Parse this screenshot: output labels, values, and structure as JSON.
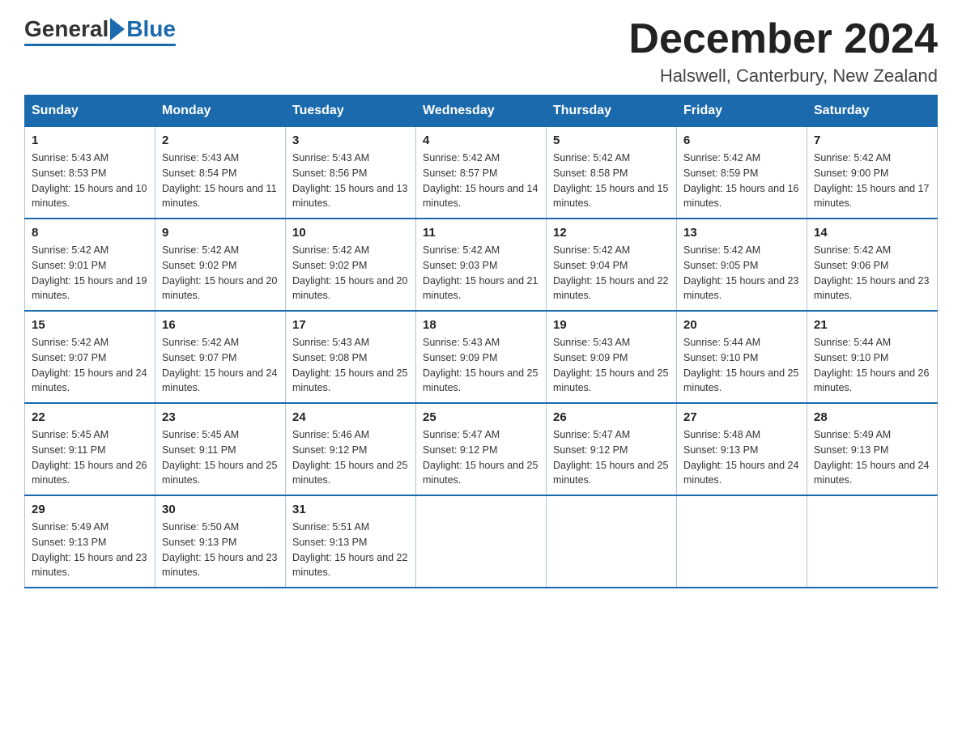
{
  "logo": {
    "general": "General",
    "blue": "Blue"
  },
  "title": "December 2024",
  "location": "Halswell, Canterbury, New Zealand",
  "days_of_week": [
    "Sunday",
    "Monday",
    "Tuesday",
    "Wednesday",
    "Thursday",
    "Friday",
    "Saturday"
  ],
  "weeks": [
    [
      {
        "day": "1",
        "sunrise": "5:43 AM",
        "sunset": "8:53 PM",
        "daylight": "15 hours and 10 minutes."
      },
      {
        "day": "2",
        "sunrise": "5:43 AM",
        "sunset": "8:54 PM",
        "daylight": "15 hours and 11 minutes."
      },
      {
        "day": "3",
        "sunrise": "5:43 AM",
        "sunset": "8:56 PM",
        "daylight": "15 hours and 13 minutes."
      },
      {
        "day": "4",
        "sunrise": "5:42 AM",
        "sunset": "8:57 PM",
        "daylight": "15 hours and 14 minutes."
      },
      {
        "day": "5",
        "sunrise": "5:42 AM",
        "sunset": "8:58 PM",
        "daylight": "15 hours and 15 minutes."
      },
      {
        "day": "6",
        "sunrise": "5:42 AM",
        "sunset": "8:59 PM",
        "daylight": "15 hours and 16 minutes."
      },
      {
        "day": "7",
        "sunrise": "5:42 AM",
        "sunset": "9:00 PM",
        "daylight": "15 hours and 17 minutes."
      }
    ],
    [
      {
        "day": "8",
        "sunrise": "5:42 AM",
        "sunset": "9:01 PM",
        "daylight": "15 hours and 19 minutes."
      },
      {
        "day": "9",
        "sunrise": "5:42 AM",
        "sunset": "9:02 PM",
        "daylight": "15 hours and 20 minutes."
      },
      {
        "day": "10",
        "sunrise": "5:42 AM",
        "sunset": "9:02 PM",
        "daylight": "15 hours and 20 minutes."
      },
      {
        "day": "11",
        "sunrise": "5:42 AM",
        "sunset": "9:03 PM",
        "daylight": "15 hours and 21 minutes."
      },
      {
        "day": "12",
        "sunrise": "5:42 AM",
        "sunset": "9:04 PM",
        "daylight": "15 hours and 22 minutes."
      },
      {
        "day": "13",
        "sunrise": "5:42 AM",
        "sunset": "9:05 PM",
        "daylight": "15 hours and 23 minutes."
      },
      {
        "day": "14",
        "sunrise": "5:42 AM",
        "sunset": "9:06 PM",
        "daylight": "15 hours and 23 minutes."
      }
    ],
    [
      {
        "day": "15",
        "sunrise": "5:42 AM",
        "sunset": "9:07 PM",
        "daylight": "15 hours and 24 minutes."
      },
      {
        "day": "16",
        "sunrise": "5:42 AM",
        "sunset": "9:07 PM",
        "daylight": "15 hours and 24 minutes."
      },
      {
        "day": "17",
        "sunrise": "5:43 AM",
        "sunset": "9:08 PM",
        "daylight": "15 hours and 25 minutes."
      },
      {
        "day": "18",
        "sunrise": "5:43 AM",
        "sunset": "9:09 PM",
        "daylight": "15 hours and 25 minutes."
      },
      {
        "day": "19",
        "sunrise": "5:43 AM",
        "sunset": "9:09 PM",
        "daylight": "15 hours and 25 minutes."
      },
      {
        "day": "20",
        "sunrise": "5:44 AM",
        "sunset": "9:10 PM",
        "daylight": "15 hours and 25 minutes."
      },
      {
        "day": "21",
        "sunrise": "5:44 AM",
        "sunset": "9:10 PM",
        "daylight": "15 hours and 26 minutes."
      }
    ],
    [
      {
        "day": "22",
        "sunrise": "5:45 AM",
        "sunset": "9:11 PM",
        "daylight": "15 hours and 26 minutes."
      },
      {
        "day": "23",
        "sunrise": "5:45 AM",
        "sunset": "9:11 PM",
        "daylight": "15 hours and 25 minutes."
      },
      {
        "day": "24",
        "sunrise": "5:46 AM",
        "sunset": "9:12 PM",
        "daylight": "15 hours and 25 minutes."
      },
      {
        "day": "25",
        "sunrise": "5:47 AM",
        "sunset": "9:12 PM",
        "daylight": "15 hours and 25 minutes."
      },
      {
        "day": "26",
        "sunrise": "5:47 AM",
        "sunset": "9:12 PM",
        "daylight": "15 hours and 25 minutes."
      },
      {
        "day": "27",
        "sunrise": "5:48 AM",
        "sunset": "9:13 PM",
        "daylight": "15 hours and 24 minutes."
      },
      {
        "day": "28",
        "sunrise": "5:49 AM",
        "sunset": "9:13 PM",
        "daylight": "15 hours and 24 minutes."
      }
    ],
    [
      {
        "day": "29",
        "sunrise": "5:49 AM",
        "sunset": "9:13 PM",
        "daylight": "15 hours and 23 minutes."
      },
      {
        "day": "30",
        "sunrise": "5:50 AM",
        "sunset": "9:13 PM",
        "daylight": "15 hours and 23 minutes."
      },
      {
        "day": "31",
        "sunrise": "5:51 AM",
        "sunset": "9:13 PM",
        "daylight": "15 hours and 22 minutes."
      },
      null,
      null,
      null,
      null
    ]
  ],
  "labels": {
    "sunrise": "Sunrise:",
    "sunset": "Sunset:",
    "daylight": "Daylight:"
  }
}
